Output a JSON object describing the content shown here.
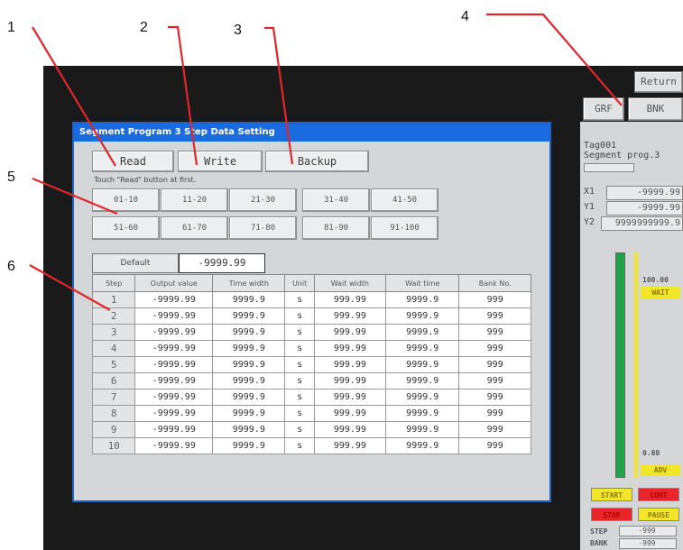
{
  "callouts": [
    "1",
    "2",
    "3",
    "4",
    "5",
    "6"
  ],
  "dialog": {
    "title": "Segment Program 3 Step Data Setting",
    "buttons": {
      "read": "Read",
      "write": "Write",
      "backup": "Backup"
    },
    "hint": "Touch \"Read\" button at first.",
    "ranges": [
      "01-10",
      "11-20",
      "21-30",
      "31-40",
      "41-50",
      "51-60",
      "61-70",
      "71-80",
      "81-90",
      "91-100"
    ],
    "default_label": "Default",
    "default_value": "-9999.99",
    "columns": [
      "Step",
      "Output value",
      "Time width",
      "Unit",
      "Wait width",
      "Wait time",
      "Bank No."
    ],
    "rows": [
      {
        "step": "1",
        "output": "-9999.99",
        "time": "9999.9",
        "unit": "s",
        "wait_width": "999.99",
        "wait_time": "9999.9",
        "bank": "999"
      },
      {
        "step": "2",
        "output": "-9999.99",
        "time": "9999.9",
        "unit": "s",
        "wait_width": "999.99",
        "wait_time": "9999.9",
        "bank": "999"
      },
      {
        "step": "3",
        "output": "-9999.99",
        "time": "9999.9",
        "unit": "s",
        "wait_width": "999.99",
        "wait_time": "9999.9",
        "bank": "999"
      },
      {
        "step": "4",
        "output": "-9999.99",
        "time": "9999.9",
        "unit": "s",
        "wait_width": "999.99",
        "wait_time": "9999.9",
        "bank": "999"
      },
      {
        "step": "5",
        "output": "-9999.99",
        "time": "9999.9",
        "unit": "s",
        "wait_width": "999.99",
        "wait_time": "9999.9",
        "bank": "999"
      },
      {
        "step": "6",
        "output": "-9999.99",
        "time": "9999.9",
        "unit": "s",
        "wait_width": "999.99",
        "wait_time": "9999.9",
        "bank": "999"
      },
      {
        "step": "7",
        "output": "-9999.99",
        "time": "9999.9",
        "unit": "s",
        "wait_width": "999.99",
        "wait_time": "9999.9",
        "bank": "999"
      },
      {
        "step": "8",
        "output": "-9999.99",
        "time": "9999.9",
        "unit": "s",
        "wait_width": "999.99",
        "wait_time": "9999.9",
        "bank": "999"
      },
      {
        "step": "9",
        "output": "-9999.99",
        "time": "9999.9",
        "unit": "s",
        "wait_width": "999.99",
        "wait_time": "9999.9",
        "bank": "999"
      },
      {
        "step": "10",
        "output": "-9999.99",
        "time": "9999.9",
        "unit": "s",
        "wait_width": "999.99",
        "wait_time": "9999.9",
        "bank": "999"
      }
    ]
  },
  "side_panel": {
    "return_label": "Return",
    "grf_label": "GRF",
    "bnk_label": "BNK",
    "tag": "Tag001",
    "program": "Segment prog.3",
    "x1_label": "X1",
    "x1_value": "-9999.99",
    "y1_label": "Y1",
    "y1_value": "-9999.99",
    "y2_label": "Y2",
    "y2_value": "9999999999.9",
    "upper_value": "100.00",
    "wait_label": "WAIT",
    "lower_value": "0.00",
    "adv_label": "ADV",
    "start_label": "START",
    "cont_label": "CONT",
    "stop_label": "STOP",
    "pause_label": "PAUSE",
    "step_label": "STEP",
    "step_value": "-999",
    "bank_label": "BANK",
    "bank_value": "-999",
    "colors": {
      "green_bar": "#1ea34a",
      "yellow_bar": "#f3e52a",
      "red": "#e8262a",
      "yellow": "#f3e52a"
    }
  }
}
